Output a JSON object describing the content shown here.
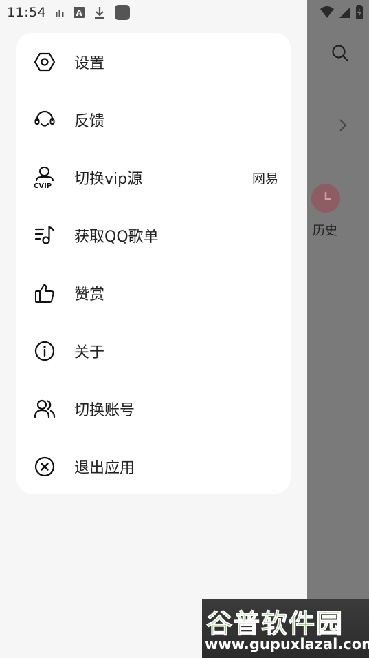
{
  "status_bar": {
    "time": "11:54"
  },
  "background": {
    "history_label": "历史"
  },
  "menu": {
    "items": [
      {
        "label": "设置",
        "icon": "hexagon-settings-icon"
      },
      {
        "label": "反馈",
        "icon": "headset-icon"
      },
      {
        "label": "切换vip源",
        "icon": "vip-user-icon",
        "value": "网易"
      },
      {
        "label": "获取QQ歌单",
        "icon": "playlist-music-icon"
      },
      {
        "label": "赞赏",
        "icon": "thumbs-up-icon"
      },
      {
        "label": "关于",
        "icon": "info-icon"
      },
      {
        "label": "切换账号",
        "icon": "users-icon"
      },
      {
        "label": "退出应用",
        "icon": "close-circle-icon"
      }
    ]
  },
  "watermark": {
    "brand": "谷普软件园",
    "url": "www.gupuxlazal.com"
  },
  "colors": {
    "overlay": "#7a7a7a",
    "drawer_bg": "#f6f6f6",
    "card_bg": "#ffffff",
    "history_icon": "#8e5c63"
  }
}
